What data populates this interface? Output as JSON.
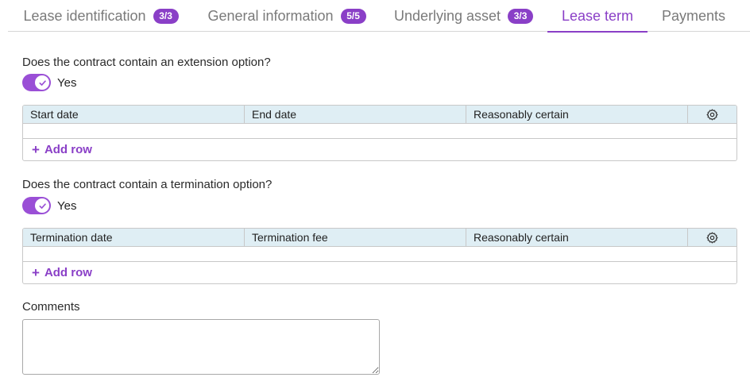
{
  "tabs": [
    {
      "label": "Lease identification",
      "badge": "3/3"
    },
    {
      "label": "General information",
      "badge": "5/5"
    },
    {
      "label": "Underlying asset",
      "badge": "3/3"
    },
    {
      "label": "Lease term",
      "active": true
    },
    {
      "label": "Payments"
    }
  ],
  "extension": {
    "question": "Does the contract contain an extension option?",
    "toggle_label": "Yes",
    "toggle_on": true,
    "columns": [
      "Start date",
      "End date",
      "Reasonably certain"
    ],
    "add_row": "Add row"
  },
  "termination": {
    "question": "Does the contract contain a termination option?",
    "toggle_label": "Yes",
    "toggle_on": true,
    "columns": [
      "Termination date",
      "Termination fee",
      "Reasonably certain"
    ],
    "add_row": "Add row"
  },
  "comments": {
    "label": "Comments",
    "value": ""
  },
  "colors": {
    "accent": "#8a3fc7",
    "toggle": "#9a4fd6",
    "table_header_bg": "#dfeef4"
  },
  "icons": {
    "toggle_knob": "check-icon",
    "table_settings": "gear-icon",
    "add": "plus-icon"
  }
}
